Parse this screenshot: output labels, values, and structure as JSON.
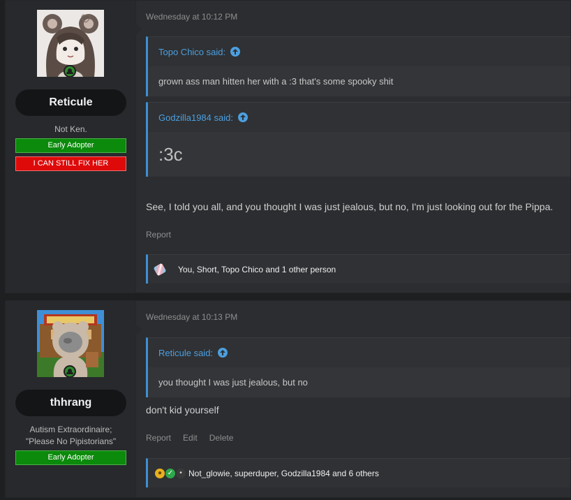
{
  "posts": [
    {
      "username": "Reticule",
      "user_title": "Not Ken.",
      "banners": [
        "Early Adopter",
        "I CAN STILL FIX HER"
      ],
      "timestamp": "Wednesday at 10:12 PM",
      "quotes": [
        {
          "author": "Topo Chico said:",
          "text": "grown ass man hitten her with a :3 that's some spooky shit"
        },
        {
          "author": "Godzilla1984 said:",
          "text": ":3c"
        }
      ],
      "text": "See, I told you all, and you thought I was just jealous, but no, I'm just looking out for the Pippa.",
      "actions": [
        "Report"
      ],
      "reactions": "You, Short, Topo Chico and 1 other person",
      "reaction_icons": [
        "trans-flag-icon",
        "rainbow-icon"
      ]
    },
    {
      "username": "thhrang",
      "user_title_lines": [
        "Autism Extraordinaire;",
        "\"Please No Pipistorians\""
      ],
      "banners": [
        "Early Adopter"
      ],
      "timestamp": "Wednesday at 10:13 PM",
      "quotes": [
        {
          "author": "Reticule said:",
          "text": "you thought I was just jealous, but no"
        }
      ],
      "text": "don't kid yourself",
      "actions": [
        "Report",
        "Edit",
        "Delete"
      ],
      "reactions": "Not_glowie, superduper, Godzilla1984 and 6 others",
      "reaction_icons": [
        "medal-icon",
        "checkmark-icon",
        "ninja-icon"
      ]
    }
  ],
  "colors": {
    "accent": "#3e8fd6",
    "online": "#2e8a2e",
    "banner_green": "#0b8a0b",
    "banner_red": "#de0a0a"
  }
}
